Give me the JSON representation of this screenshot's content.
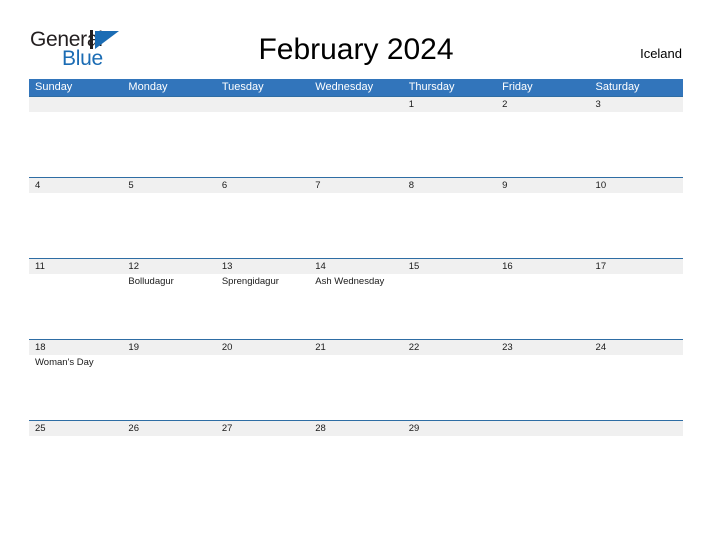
{
  "brand": {
    "name_part1": "General",
    "name_part2": "Blue",
    "mark_icon": "triangle-logo-icon",
    "color_dark": "#231f20",
    "color_blue": "#1b6cb4"
  },
  "header": {
    "title": "February 2024",
    "country": "Iceland"
  },
  "theme": {
    "header_blue": "#3275bb",
    "row_line_blue": "#2e6da4",
    "date_band_grey": "#f0f0f0",
    "text_dark": "#1a1a1a",
    "page_background": "#ffffff"
  },
  "calendar": {
    "weekdays": [
      "Sunday",
      "Monday",
      "Tuesday",
      "Wednesday",
      "Thursday",
      "Friday",
      "Saturday"
    ],
    "weeks": [
      {
        "days": [
          {
            "date": "",
            "event": ""
          },
          {
            "date": "",
            "event": ""
          },
          {
            "date": "",
            "event": ""
          },
          {
            "date": "",
            "event": ""
          },
          {
            "date": "1",
            "event": ""
          },
          {
            "date": "2",
            "event": ""
          },
          {
            "date": "3",
            "event": ""
          }
        ]
      },
      {
        "days": [
          {
            "date": "4",
            "event": ""
          },
          {
            "date": "5",
            "event": ""
          },
          {
            "date": "6",
            "event": ""
          },
          {
            "date": "7",
            "event": ""
          },
          {
            "date": "8",
            "event": ""
          },
          {
            "date": "9",
            "event": ""
          },
          {
            "date": "10",
            "event": ""
          }
        ]
      },
      {
        "days": [
          {
            "date": "11",
            "event": ""
          },
          {
            "date": "12",
            "event": "Bolludagur"
          },
          {
            "date": "13",
            "event": "Sprengidagur"
          },
          {
            "date": "14",
            "event": "Ash Wednesday"
          },
          {
            "date": "15",
            "event": ""
          },
          {
            "date": "16",
            "event": ""
          },
          {
            "date": "17",
            "event": ""
          }
        ]
      },
      {
        "days": [
          {
            "date": "18",
            "event": "Woman's Day"
          },
          {
            "date": "19",
            "event": ""
          },
          {
            "date": "20",
            "event": ""
          },
          {
            "date": "21",
            "event": ""
          },
          {
            "date": "22",
            "event": ""
          },
          {
            "date": "23",
            "event": ""
          },
          {
            "date": "24",
            "event": ""
          }
        ]
      },
      {
        "days": [
          {
            "date": "25",
            "event": ""
          },
          {
            "date": "26",
            "event": ""
          },
          {
            "date": "27",
            "event": ""
          },
          {
            "date": "28",
            "event": ""
          },
          {
            "date": "29",
            "event": ""
          },
          {
            "date": "",
            "event": ""
          },
          {
            "date": "",
            "event": ""
          }
        ]
      }
    ]
  }
}
